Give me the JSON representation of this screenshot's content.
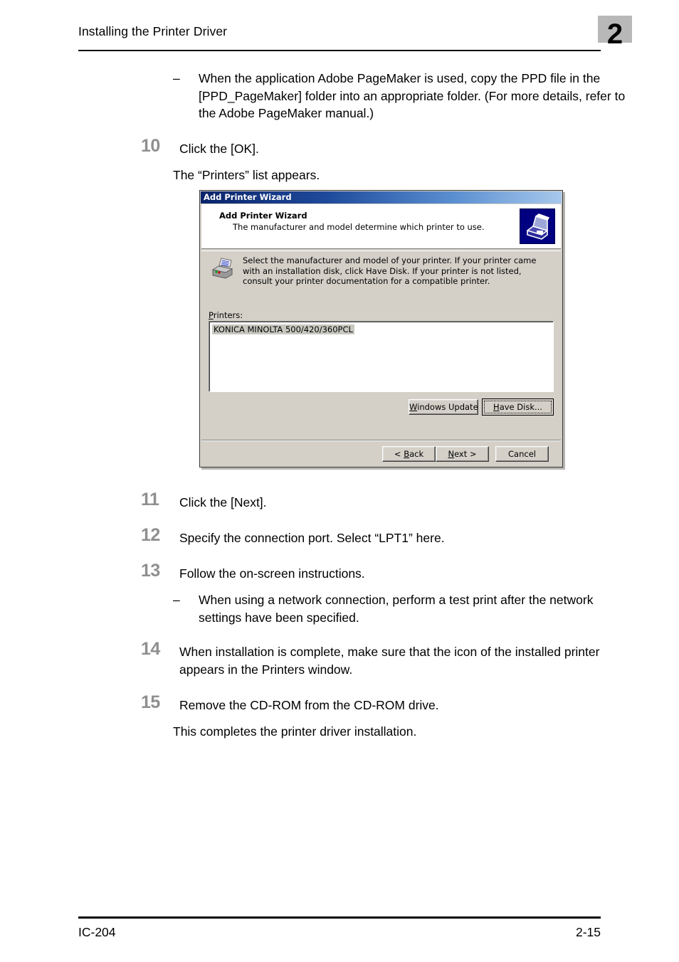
{
  "header": {
    "title": "Installing the Printer Driver",
    "chapter_number": "2"
  },
  "intro_bullet": {
    "marker": "–",
    "text": "When the application Adobe PageMaker is used, copy the PPD file in the [PPD_PageMaker] folder into an appropriate folder. (For more details, refer to the Adobe PageMaker manual.)"
  },
  "steps": [
    {
      "number": "10",
      "text": "Click the [OK].",
      "note": "The “Printers” list appears."
    },
    {
      "number": "11",
      "text": "Click the [Next]."
    },
    {
      "number": "12",
      "text": "Specify the connection port. Select “LPT1” here."
    },
    {
      "number": "13",
      "text": "Follow the on-screen instructions.",
      "bullet_marker": "–",
      "bullet_text": "When using a network connection, perform a test print after the network settings have been specified."
    },
    {
      "number": "14",
      "text": "When installation is complete, make sure that the icon of the installed printer appears in the Printers window."
    },
    {
      "number": "15",
      "text": "Remove the CD-ROM from the CD-ROM drive.",
      "note": "This completes the printer driver installation."
    }
  ],
  "dialog": {
    "titlebar": "Add Printer Wizard",
    "header_title": "Add Printer Wizard",
    "header_subtitle": "The manufacturer and model determine which printer to use.",
    "body_text": "Select the manufacturer and model of your printer. If your printer came with an installation disk, click Have Disk. If your printer is not listed, consult your printer documentation for a compatible printer.",
    "printers_label": "Printers:",
    "printers_label_accel": "P",
    "printers_label_rest": "rinters:",
    "printer_list": [
      "KONICA MINOLTA 500/420/360PCL"
    ],
    "selected_printer": "KONICA MINOLTA 500/420/360PCL",
    "buttons": {
      "windows_update": {
        "accel": "W",
        "rest": "indows Update"
      },
      "have_disk": {
        "accel": "H",
        "rest": "ave Disk..."
      },
      "back": {
        "prefix": "< ",
        "accel": "B",
        "rest": "ack"
      },
      "next": {
        "accel": "N",
        "rest": "ext >"
      },
      "cancel": {
        "label": "Cancel"
      }
    },
    "icons": {
      "header": "printer-wizard-icon",
      "body": "printer-icon"
    },
    "colors": {
      "titlebar_start": "#0a246a",
      "titlebar_end": "#a8c8ec",
      "face": "#d4d0c8",
      "selection": "#c8c8c0"
    }
  },
  "footer": {
    "left": "IC-204",
    "right": "2-15"
  }
}
